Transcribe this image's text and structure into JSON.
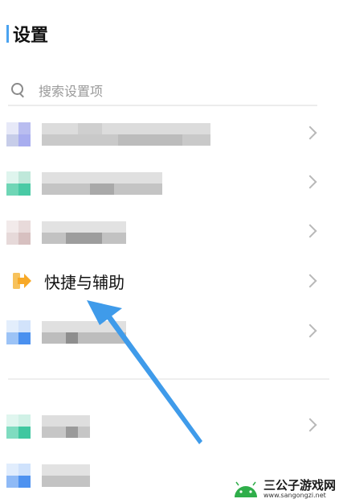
{
  "header": {
    "title": "设置"
  },
  "search": {
    "placeholder": "搜索设置项",
    "icon": "search-icon"
  },
  "rows": [
    {
      "label_visible": false,
      "icon_colors": [
        "#e7e9f8",
        "#b9bdf0",
        "#c7cde9",
        "#a8adef"
      ]
    },
    {
      "label_visible": false,
      "icon_colors": [
        "#dff5ee",
        "#bfe8da",
        "#6fd6b6",
        "#49caa5"
      ]
    },
    {
      "label_visible": false,
      "icon_colors": [
        "#f2eaea",
        "#e8dada",
        "#e6d9d9",
        "#d7c0c0"
      ]
    },
    {
      "label": "快捷与辅助",
      "icon": "arrow-right-icon",
      "icon_color": "#f7a928"
    },
    {
      "label_visible": false,
      "icon_colors": [
        "#e3eefc",
        "#d2e3fb",
        "#9cc3f6",
        "#4a90ef"
      ]
    },
    {
      "label_visible": false,
      "icon_colors": [
        "#e0f6ef",
        "#d0f1e6",
        "#7fdcc0",
        "#40c7a0"
      ]
    },
    {
      "label_visible": false,
      "icon_colors": [
        "#e1edfd",
        "#cfe2fc",
        "#8fbaf6",
        "#4e92f0"
      ]
    }
  ],
  "watermark": {
    "name": "三公子游戏网",
    "url": "www.sangongzi.net"
  },
  "colors": {
    "accent": "#4aa3f0",
    "arrow": "#3f9bea"
  }
}
